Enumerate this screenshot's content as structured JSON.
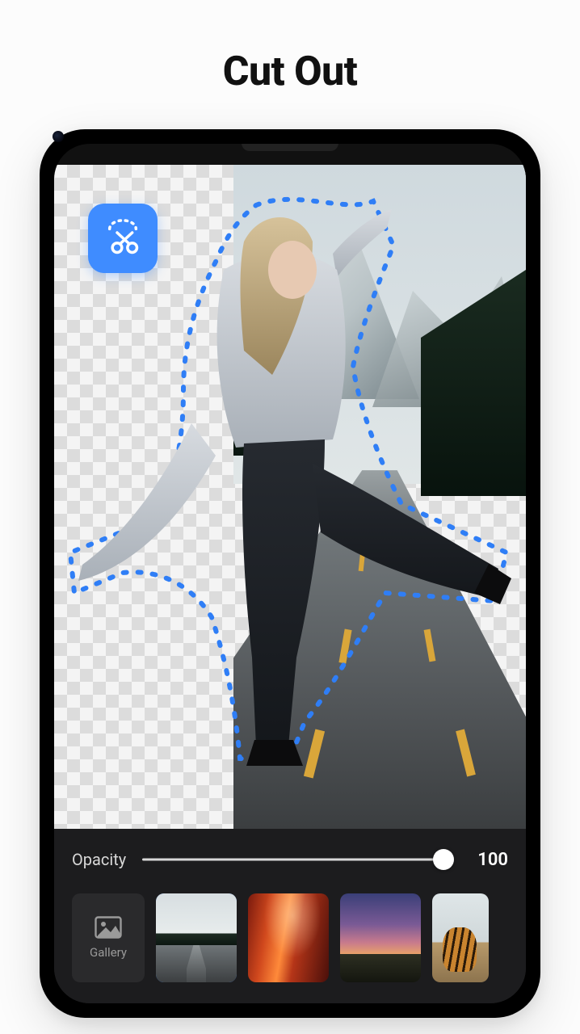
{
  "page_title": "Cut Out",
  "canvas": {
    "cut_tool_icon": "scissors-lasso-icon"
  },
  "controls": {
    "opacity_label": "Opacity",
    "opacity_value": "100",
    "opacity_percent": 100
  },
  "gallery": {
    "button_label": "Gallery",
    "icon": "image-icon"
  },
  "backgrounds": [
    {
      "name": "mountain-road",
      "selected": true
    },
    {
      "name": "canyon-red",
      "selected": false
    },
    {
      "name": "sunset-field",
      "selected": false
    },
    {
      "name": "tiger-walk",
      "selected": false
    }
  ],
  "colors": {
    "accent": "#3f8cff",
    "panel": "#1c1c1e"
  }
}
